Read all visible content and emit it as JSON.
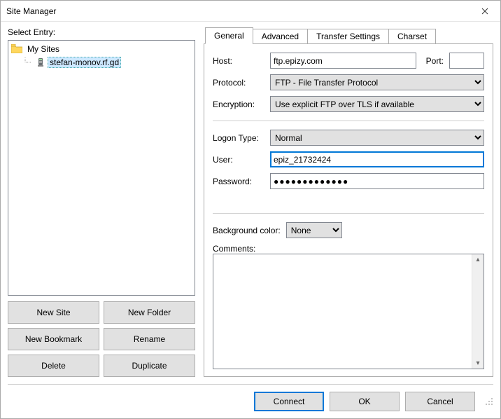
{
  "window": {
    "title": "Site Manager"
  },
  "left": {
    "select_entry_label_pre": "",
    "select_entry_u": "S",
    "select_entry_label_post": "elect Entry:",
    "tree": {
      "root_label": "My Sites",
      "site_label": "stefan-monov.rf.gd"
    },
    "buttons": {
      "new_site_pre": "",
      "new_site_u": "N",
      "new_site_post": "ew Site",
      "new_folder": "New Folder",
      "new_bookmark_pre": "New Book",
      "new_bookmark_u": "m",
      "new_bookmark_post": "ark",
      "rename_pre": "",
      "rename_u": "R",
      "rename_post": "ename",
      "delete_pre": "",
      "delete_u": "D",
      "delete_post": "elete",
      "duplicate_pre": "Dupl",
      "duplicate_u": "i",
      "duplicate_post": "cate"
    }
  },
  "tabs": {
    "general": "General",
    "advanced": "Advanced",
    "transfer": "Transfer Settings",
    "charset": "Charset"
  },
  "general": {
    "host_label_u": "H",
    "host_label_post": "ost:",
    "host_value": "ftp.epizy.com",
    "port_label_u": "P",
    "port_label_post": "ort:",
    "port_value": "",
    "protocol_label_pre": "Pro",
    "protocol_label_u": "t",
    "protocol_label_post": "ocol:",
    "protocol_value": "FTP - File Transfer Protocol",
    "encryption_label_u": "E",
    "encryption_label_post": "ncryption:",
    "encryption_value": "Use explicit FTP over TLS if available",
    "logon_label_u": "L",
    "logon_label_post": "ogon Type:",
    "logon_value": "Normal",
    "user_label_u": "U",
    "user_label_post": "ser:",
    "user_value": "epiz_21732424",
    "password_label_pre": "Pass",
    "password_label_u": "w",
    "password_label_post": "ord:",
    "password_value": "●●●●●●●●●●●●●",
    "bg_label_u": "B",
    "bg_label_post": "ackground color:",
    "bg_value": "None",
    "comments_label_pre": "Co",
    "comments_label_u": "m",
    "comments_label_post": "ments:"
  },
  "bottom": {
    "connect_u": "C",
    "connect_post": "onnect",
    "ok": "OK",
    "cancel": "Cancel"
  }
}
